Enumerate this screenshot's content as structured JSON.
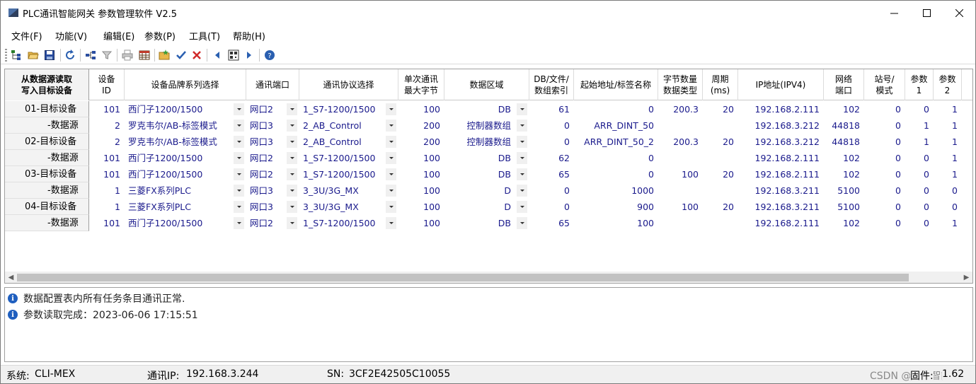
{
  "window": {
    "title": "PLC通讯智能网关 参数管理软件 V2.5"
  },
  "menu": [
    "文件(F)",
    "功能(V)",
    "编辑(E)",
    "参数(P)",
    "工具(T)",
    "帮助(H)"
  ],
  "toolbar": {
    "icons": [
      "tree-icon",
      "open-folder-icon",
      "save-icon",
      "refresh-icon",
      "network-icon",
      "filter-icon",
      "printer-icon",
      "table-icon",
      "folder-star-icon",
      "check-icon",
      "delete-icon",
      "arrow-left-icon",
      "qr-icon",
      "arrow-right-icon",
      "help-icon"
    ]
  },
  "grid": {
    "corner_header": "从数据源读取\n写入目标设备",
    "columns": [
      "设备\nID",
      "设备品牌系列选择",
      "通讯端口",
      "通讯协议选择",
      "单次通讯\n最大字节",
      "数据区域",
      "DB/文件/\n数组索引",
      "起始地址/标签名称",
      "字节数量\n数据类型",
      "周期\n(ms)",
      "IP地址(IPV4)",
      "网络\n端口",
      "站号/\n模式",
      "参数\n1",
      "参数\n2"
    ],
    "rows": [
      {
        "header": "01-目标设备",
        "kind": "dev",
        "selected": true,
        "id": "101",
        "brand": "西门子1200/1500",
        "port": "网口2",
        "protocol": "1_S7-1200/1500",
        "maxbytes": "100",
        "area": "DB",
        "index": "61",
        "address": "0",
        "bytes": "200.3",
        "period": "20",
        "ip": "192.168.2.111",
        "netport": "102",
        "station": "0",
        "p1": "0",
        "p2": "1"
      },
      {
        "header": "-数据源",
        "kind": "src",
        "selected": false,
        "id": "2",
        "brand": "罗克韦尔/AB-标签模式",
        "port": "网口3",
        "protocol": "2_AB_Control",
        "maxbytes": "200",
        "area": "控制器数组",
        "index": "0",
        "address": "ARR_DINT_50",
        "bytes": "",
        "period": "",
        "ip": "192.168.3.212",
        "netport": "44818",
        "station": "0",
        "p1": "1",
        "p2": "1"
      },
      {
        "header": "02-目标设备",
        "kind": "dev",
        "selected": false,
        "id": "2",
        "brand": "罗克韦尔/AB-标签模式",
        "port": "网口3",
        "protocol": "2_AB_Control",
        "maxbytes": "200",
        "area": "控制器数组",
        "index": "0",
        "address": "ARR_DINT_50_2",
        "bytes": "200.3",
        "period": "20",
        "ip": "192.168.3.212",
        "netport": "44818",
        "station": "0",
        "p1": "1",
        "p2": "1"
      },
      {
        "header": "-数据源",
        "kind": "src",
        "selected": false,
        "id": "101",
        "brand": "西门子1200/1500",
        "port": "网口2",
        "protocol": "1_S7-1200/1500",
        "maxbytes": "100",
        "area": "DB",
        "index": "62",
        "address": "0",
        "bytes": "",
        "period": "",
        "ip": "192.168.2.111",
        "netport": "102",
        "station": "0",
        "p1": "0",
        "p2": "1"
      },
      {
        "header": "03-目标设备",
        "kind": "dev",
        "selected": false,
        "id": "101",
        "brand": "西门子1200/1500",
        "port": "网口2",
        "protocol": "1_S7-1200/1500",
        "maxbytes": "100",
        "area": "DB",
        "index": "65",
        "address": "0",
        "bytes": "100",
        "period": "20",
        "ip": "192.168.2.111",
        "netport": "102",
        "station": "0",
        "p1": "0",
        "p2": "1"
      },
      {
        "header": "-数据源",
        "kind": "src",
        "selected": false,
        "id": "1",
        "brand": "三菱FX系列PLC",
        "port": "网口3",
        "protocol": "3_3U/3G_MX",
        "maxbytes": "100",
        "area": "D",
        "index": "0",
        "address": "1000",
        "bytes": "",
        "period": "",
        "ip": "192.168.3.211",
        "netport": "5100",
        "station": "0",
        "p1": "0",
        "p2": "0"
      },
      {
        "header": "04-目标设备",
        "kind": "dev",
        "selected": false,
        "id": "1",
        "brand": "三菱FX系列PLC",
        "port": "网口3",
        "protocol": "3_3U/3G_MX",
        "maxbytes": "100",
        "area": "D",
        "index": "0",
        "address": "900",
        "bytes": "100",
        "period": "20",
        "ip": "192.168.3.211",
        "netport": "5100",
        "station": "0",
        "p1": "0",
        "p2": "0"
      },
      {
        "header": "-数据源",
        "kind": "src",
        "selected": false,
        "id": "101",
        "brand": "西门子1200/1500",
        "port": "网口2",
        "protocol": "1_S7-1200/1500",
        "maxbytes": "100",
        "area": "DB",
        "index": "65",
        "address": "100",
        "bytes": "",
        "period": "",
        "ip": "192.168.2.111",
        "netport": "102",
        "station": "0",
        "p1": "0",
        "p2": "1"
      }
    ]
  },
  "log": [
    "数据配置表内所有任务条目通讯正常.",
    "参数读取完成：2023-06-06 17:15:51"
  ],
  "status": {
    "system_label": "系统:",
    "system_value": "CLI-MEX",
    "ip_label": "通讯IP:",
    "ip_value": "192.168.3.244",
    "sn_label": "SN:",
    "sn_value": "3CF2E42505C10055",
    "fw_label": "固件:",
    "fw_value": "1.62"
  },
  "watermark": "CSDN @泗和智能",
  "colors": {
    "cell_text": "#1a1a8c",
    "info_icon": "#1f5fbf",
    "scroll_thumb": "#c2c2c2"
  }
}
